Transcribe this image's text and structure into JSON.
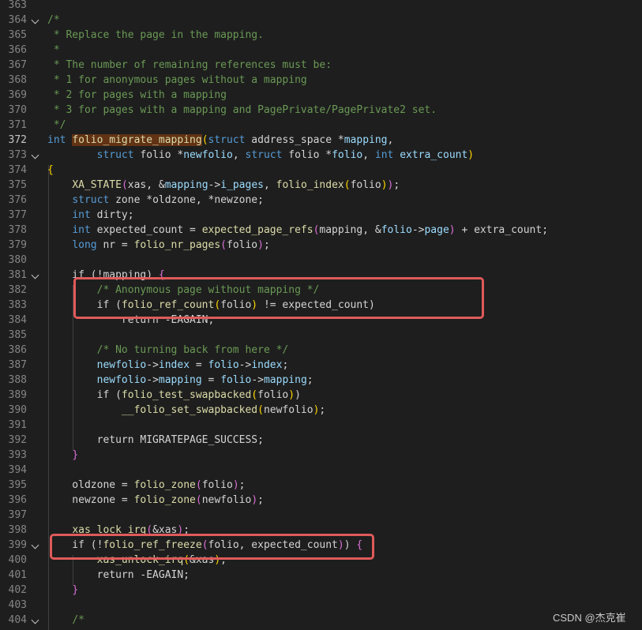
{
  "editor": {
    "active_line": "372",
    "lines": [
      {
        "num": "363",
        "fold": false,
        "tokens": []
      },
      {
        "num": "364",
        "fold": true,
        "tokens": [
          [
            "c",
            "/*"
          ]
        ]
      },
      {
        "num": "365",
        "fold": false,
        "tokens": [
          [
            "c",
            " * Replace the page in the mapping."
          ]
        ]
      },
      {
        "num": "366",
        "fold": false,
        "tokens": [
          [
            "c",
            " *"
          ]
        ]
      },
      {
        "num": "367",
        "fold": false,
        "tokens": [
          [
            "c",
            " * The number of remaining references must be:"
          ]
        ]
      },
      {
        "num": "368",
        "fold": false,
        "tokens": [
          [
            "c",
            " * 1 for anonymous pages without a mapping"
          ]
        ]
      },
      {
        "num": "369",
        "fold": false,
        "tokens": [
          [
            "c",
            " * 2 for pages with a mapping"
          ]
        ]
      },
      {
        "num": "370",
        "fold": false,
        "tokens": [
          [
            "c",
            " * 3 for pages with a mapping and PagePrivate/PagePrivate2 set."
          ]
        ]
      },
      {
        "num": "371",
        "fold": false,
        "tokens": [
          [
            "c",
            " */"
          ]
        ]
      },
      {
        "num": "372",
        "fold": false,
        "tokens": [
          [
            "k",
            "int"
          ],
          [
            "p",
            " "
          ],
          [
            "f hl",
            "folio_migrate_mapping"
          ],
          [
            "b1",
            "("
          ],
          [
            "k",
            "struct"
          ],
          [
            "p",
            " address_space *"
          ],
          [
            "v",
            "mapping"
          ],
          [
            "p",
            ","
          ]
        ]
      },
      {
        "num": "373",
        "fold": true,
        "tokens": [
          [
            "p",
            "        "
          ],
          [
            "k",
            "struct"
          ],
          [
            "p",
            " folio *"
          ],
          [
            "v",
            "newfolio"
          ],
          [
            "p",
            ", "
          ],
          [
            "k",
            "struct"
          ],
          [
            "p",
            " folio *"
          ],
          [
            "v",
            "folio"
          ],
          [
            "p",
            ", "
          ],
          [
            "k",
            "int"
          ],
          [
            "p",
            " "
          ],
          [
            "v",
            "extra_count"
          ],
          [
            "b1",
            ")"
          ]
        ]
      },
      {
        "num": "374",
        "fold": false,
        "tokens": [
          [
            "b1",
            "{"
          ]
        ]
      },
      {
        "num": "375",
        "fold": false,
        "tokens": [
          [
            "p",
            "    "
          ],
          [
            "f",
            "XA_STATE"
          ],
          [
            "b2",
            "("
          ],
          [
            "p",
            "xas, &"
          ],
          [
            "v",
            "mapping"
          ],
          [
            "p",
            "->"
          ],
          [
            "v",
            "i_pages"
          ],
          [
            "p",
            ", "
          ],
          [
            "f",
            "folio_index"
          ],
          [
            "b1",
            "("
          ],
          [
            "p",
            "folio"
          ],
          [
            "b1",
            ")"
          ],
          [
            "b2",
            ")"
          ],
          [
            "p",
            ";"
          ]
        ]
      },
      {
        "num": "376",
        "fold": false,
        "tokens": [
          [
            "p",
            "    "
          ],
          [
            "k",
            "struct"
          ],
          [
            "p",
            " zone *oldzone, *newzone;"
          ]
        ]
      },
      {
        "num": "377",
        "fold": false,
        "tokens": [
          [
            "p",
            "    "
          ],
          [
            "k",
            "int"
          ],
          [
            "p",
            " dirty;"
          ]
        ]
      },
      {
        "num": "378",
        "fold": false,
        "tokens": [
          [
            "p",
            "    "
          ],
          [
            "k",
            "int"
          ],
          [
            "p",
            " expected_count = "
          ],
          [
            "f",
            "expected_page_refs"
          ],
          [
            "b2",
            "("
          ],
          [
            "p",
            "mapping, &"
          ],
          [
            "v",
            "folio"
          ],
          [
            "p",
            "->"
          ],
          [
            "v",
            "page"
          ],
          [
            "b2",
            ")"
          ],
          [
            "p",
            " + extra_count;"
          ]
        ]
      },
      {
        "num": "379",
        "fold": false,
        "tokens": [
          [
            "p",
            "    "
          ],
          [
            "k",
            "long"
          ],
          [
            "p",
            " nr = "
          ],
          [
            "f",
            "folio_nr_pages"
          ],
          [
            "b2",
            "("
          ],
          [
            "p",
            "folio"
          ],
          [
            "b2",
            ")"
          ],
          [
            "p",
            ";"
          ]
        ]
      },
      {
        "num": "380",
        "fold": false,
        "tokens": []
      },
      {
        "num": "381",
        "fold": true,
        "tokens": [
          [
            "p",
            "    if ("
          ],
          [
            "p",
            "!mapping"
          ],
          [
            "p",
            ") "
          ],
          [
            "b2",
            "{"
          ]
        ]
      },
      {
        "num": "382",
        "fold": false,
        "tokens": [
          [
            "p",
            "        "
          ],
          [
            "c",
            "/* Anonymous page without mapping */"
          ]
        ]
      },
      {
        "num": "383",
        "fold": false,
        "tokens": [
          [
            "p",
            "        if ("
          ],
          [
            "f",
            "folio_ref_count"
          ],
          [
            "b1",
            "("
          ],
          [
            "p",
            "folio"
          ],
          [
            "b1",
            ")"
          ],
          [
            "p",
            " != expected_count)"
          ]
        ]
      },
      {
        "num": "384",
        "fold": false,
        "tokens": [
          [
            "p",
            "            return -EAGAIN;"
          ]
        ]
      },
      {
        "num": "385",
        "fold": false,
        "tokens": []
      },
      {
        "num": "386",
        "fold": false,
        "tokens": [
          [
            "p",
            "        "
          ],
          [
            "c",
            "/* No turning back from here */"
          ]
        ]
      },
      {
        "num": "387",
        "fold": false,
        "tokens": [
          [
            "p",
            "        "
          ],
          [
            "v",
            "newfolio"
          ],
          [
            "p",
            "->"
          ],
          [
            "v",
            "index"
          ],
          [
            "p",
            " = "
          ],
          [
            "v",
            "folio"
          ],
          [
            "p",
            "->"
          ],
          [
            "v",
            "index"
          ],
          [
            "p",
            ";"
          ]
        ]
      },
      {
        "num": "388",
        "fold": false,
        "tokens": [
          [
            "p",
            "        "
          ],
          [
            "v",
            "newfolio"
          ],
          [
            "p",
            "->"
          ],
          [
            "v",
            "mapping"
          ],
          [
            "p",
            " = "
          ],
          [
            "v",
            "folio"
          ],
          [
            "p",
            "->"
          ],
          [
            "v",
            "mapping"
          ],
          [
            "p",
            ";"
          ]
        ]
      },
      {
        "num": "389",
        "fold": false,
        "tokens": [
          [
            "p",
            "        if ("
          ],
          [
            "f",
            "folio_test_swapbacked"
          ],
          [
            "b1",
            "("
          ],
          [
            "p",
            "folio"
          ],
          [
            "b1",
            ")"
          ],
          [
            "p",
            ")"
          ]
        ]
      },
      {
        "num": "390",
        "fold": false,
        "tokens": [
          [
            "p",
            "            "
          ],
          [
            "f",
            "__folio_set_swapbacked"
          ],
          [
            "b1",
            "("
          ],
          [
            "p",
            "newfolio"
          ],
          [
            "b1",
            ")"
          ],
          [
            "p",
            ";"
          ]
        ]
      },
      {
        "num": "391",
        "fold": false,
        "tokens": []
      },
      {
        "num": "392",
        "fold": false,
        "tokens": [
          [
            "p",
            "        return MIGRATEPAGE_SUCCESS;"
          ]
        ]
      },
      {
        "num": "393",
        "fold": false,
        "tokens": [
          [
            "p",
            "    "
          ],
          [
            "b2",
            "}"
          ]
        ]
      },
      {
        "num": "394",
        "fold": false,
        "tokens": []
      },
      {
        "num": "395",
        "fold": false,
        "tokens": [
          [
            "p",
            "    oldzone = "
          ],
          [
            "f",
            "folio_zone"
          ],
          [
            "b2",
            "("
          ],
          [
            "p",
            "folio"
          ],
          [
            "b2",
            ")"
          ],
          [
            "p",
            ";"
          ]
        ]
      },
      {
        "num": "396",
        "fold": false,
        "tokens": [
          [
            "p",
            "    newzone = "
          ],
          [
            "f",
            "folio_zone"
          ],
          [
            "b2",
            "("
          ],
          [
            "p",
            "newfolio"
          ],
          [
            "b2",
            ")"
          ],
          [
            "p",
            ";"
          ]
        ]
      },
      {
        "num": "397",
        "fold": false,
        "tokens": []
      },
      {
        "num": "398",
        "fold": false,
        "tokens": [
          [
            "p",
            "    "
          ],
          [
            "f",
            "xas_lock_irq"
          ],
          [
            "b2",
            "("
          ],
          [
            "p",
            "&xas"
          ],
          [
            "b2",
            ")"
          ],
          [
            "p",
            ";"
          ]
        ]
      },
      {
        "num": "399",
        "fold": true,
        "tokens": [
          [
            "p",
            "    if (!"
          ],
          [
            "f",
            "folio_ref_freeze"
          ],
          [
            "b2",
            "("
          ],
          [
            "p",
            "folio, expected_count"
          ],
          [
            "b2",
            ")"
          ],
          [
            "p",
            ") "
          ],
          [
            "b2",
            "{"
          ]
        ]
      },
      {
        "num": "400",
        "fold": false,
        "tokens": [
          [
            "p",
            "        "
          ],
          [
            "f",
            "xas_unlock_irq"
          ],
          [
            "b1",
            "("
          ],
          [
            "p",
            "&xas"
          ],
          [
            "b1",
            ")"
          ],
          [
            "p",
            ";"
          ]
        ]
      },
      {
        "num": "401",
        "fold": false,
        "tokens": [
          [
            "p",
            "        return -EAGAIN;"
          ]
        ]
      },
      {
        "num": "402",
        "fold": false,
        "tokens": [
          [
            "p",
            "    "
          ],
          [
            "b2",
            "}"
          ]
        ]
      },
      {
        "num": "403",
        "fold": false,
        "tokens": []
      },
      {
        "num": "404",
        "fold": true,
        "tokens": [
          [
            "p",
            "    "
          ],
          [
            "c",
            "/*"
          ]
        ]
      }
    ]
  },
  "watermark": "CSDN @杰克崔"
}
